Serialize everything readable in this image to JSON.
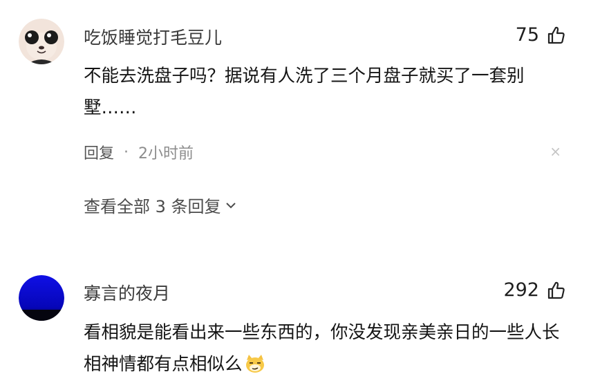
{
  "comments": [
    {
      "username": "吃饭睡觉打毛豆儿",
      "likes": "75",
      "text": "不能去洗盘子吗？据说有人洗了三个月盘子就买了一套别墅……",
      "reply_label": "回复",
      "separator": "·",
      "time": "2小时前",
      "dismiss": "×",
      "view_replies": "查看全部 3 条回复",
      "avatar_icon": "cartoon-avatar-icon"
    },
    {
      "username": "寡言的夜月",
      "likes": "292",
      "text": "看相貌是能看出来一些东西的，你没发现亲美亲日的一些人长相神情都有点相似么",
      "emoji": "smirk-cat-emoji-icon",
      "avatar_icon": "blue-night-avatar-icon"
    }
  ],
  "colors": {
    "text": "#151515",
    "meta": "#8c8c8c",
    "dismiss": "#c4c4c4",
    "avatar2_blue": "#0a0ad0"
  }
}
